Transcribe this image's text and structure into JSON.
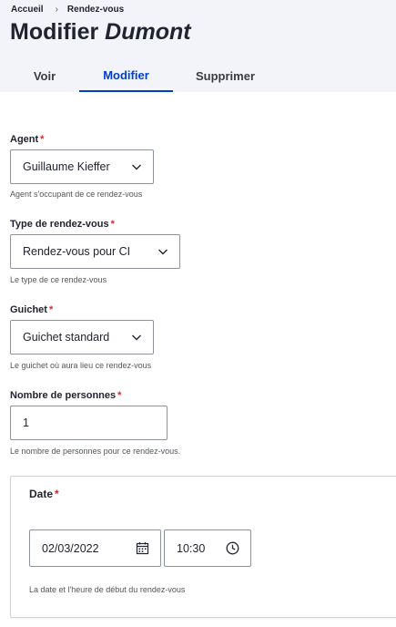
{
  "breadcrumb": {
    "home": "Accueil",
    "separator": "›",
    "current": "Rendez-vous"
  },
  "page": {
    "title_prefix": "Modifier",
    "title_name": "Dumont"
  },
  "tabs": [
    {
      "label": "Voir",
      "active": false
    },
    {
      "label": "Modifier",
      "active": true
    },
    {
      "label": "Supprimer",
      "active": false
    }
  ],
  "form": {
    "required_marker": "*",
    "agent": {
      "label": "Agent",
      "value": "Guillaume Kieffer",
      "description": "Agent s'occupant de ce rendez-vous"
    },
    "type": {
      "label": "Type de rendez-vous",
      "value": "Rendez-vous pour CI",
      "description": "Le type de ce rendez-vous"
    },
    "guichet": {
      "label": "Guichet",
      "value": "Guichet standard",
      "description": "Le guichet où aura lieu ce rendez-vous"
    },
    "personnes": {
      "label": "Nombre de personnes",
      "value": "1",
      "description": "Le nombre de personnes pour ce rendez-vous."
    },
    "date": {
      "label": "Date",
      "date_value": "02/03/2022",
      "time_value": "10:30",
      "description": "La date et l'heure de début du rendez-vous"
    }
  },
  "colors": {
    "accent": "#003ecc",
    "required": "#dc2323",
    "header_bg": "#f3f4f9"
  },
  "icons": {
    "select": "chevron-down-icon",
    "date": "calendar-icon",
    "time": "clock-icon"
  }
}
